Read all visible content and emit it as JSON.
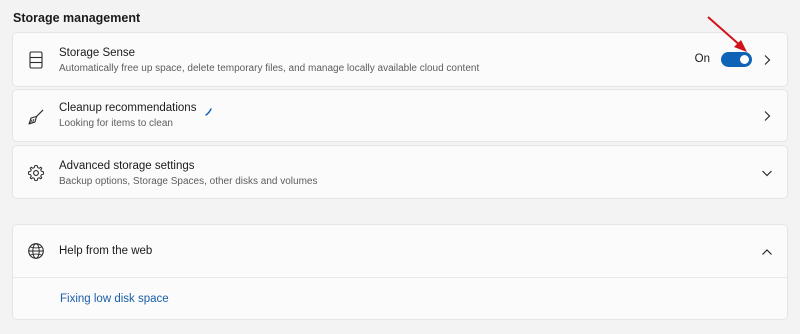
{
  "section": {
    "title": "Storage management"
  },
  "items": [
    {
      "title": "Storage Sense",
      "subtitle": "Automatically free up space, delete temporary files, and manage locally available cloud content",
      "icon": "storage-drive-icon",
      "toggle": {
        "label": "On",
        "state": true
      }
    },
    {
      "title": "Cleanup recommendations",
      "subtitle": "Looking for items to clean",
      "icon": "broom-icon"
    },
    {
      "title": "Advanced storage settings",
      "subtitle": "Backup options, Storage Spaces, other disks and volumes",
      "icon": "gear-icon"
    }
  ],
  "help": {
    "title": "Help from the web",
    "icon": "globe-icon",
    "link": "Fixing low disk space"
  },
  "colors": {
    "accent": "#0f63b7",
    "link": "#1a5fa8",
    "annotation_arrow": "#d0121b",
    "background": "#f3f3f3",
    "card": "#fbfbfb"
  }
}
